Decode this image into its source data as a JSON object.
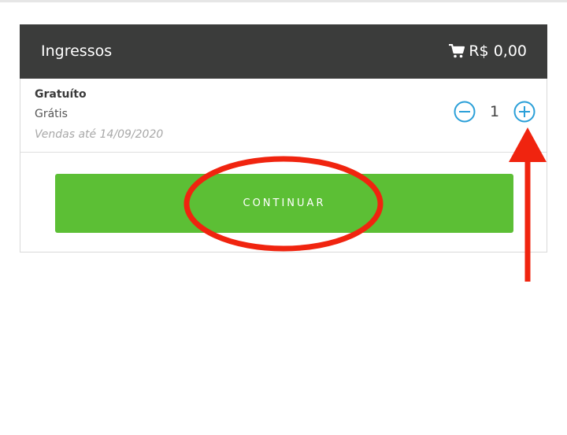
{
  "header": {
    "title": "Ingressos",
    "cart_total": "R$ 0,00",
    "cart_icon": "shopping-cart-icon"
  },
  "ticket": {
    "name": "Gratuíto",
    "price": "Grátis",
    "sales_until": "Vendas até 14/09/2020",
    "quantity": "1"
  },
  "actions": {
    "continue_label": "CONTINUAR"
  },
  "colors": {
    "header_bg": "#3b3c3b",
    "accent_blue": "#2a9fd8",
    "continue_green": "#5cbf35",
    "annotation_red": "#f0240f"
  }
}
